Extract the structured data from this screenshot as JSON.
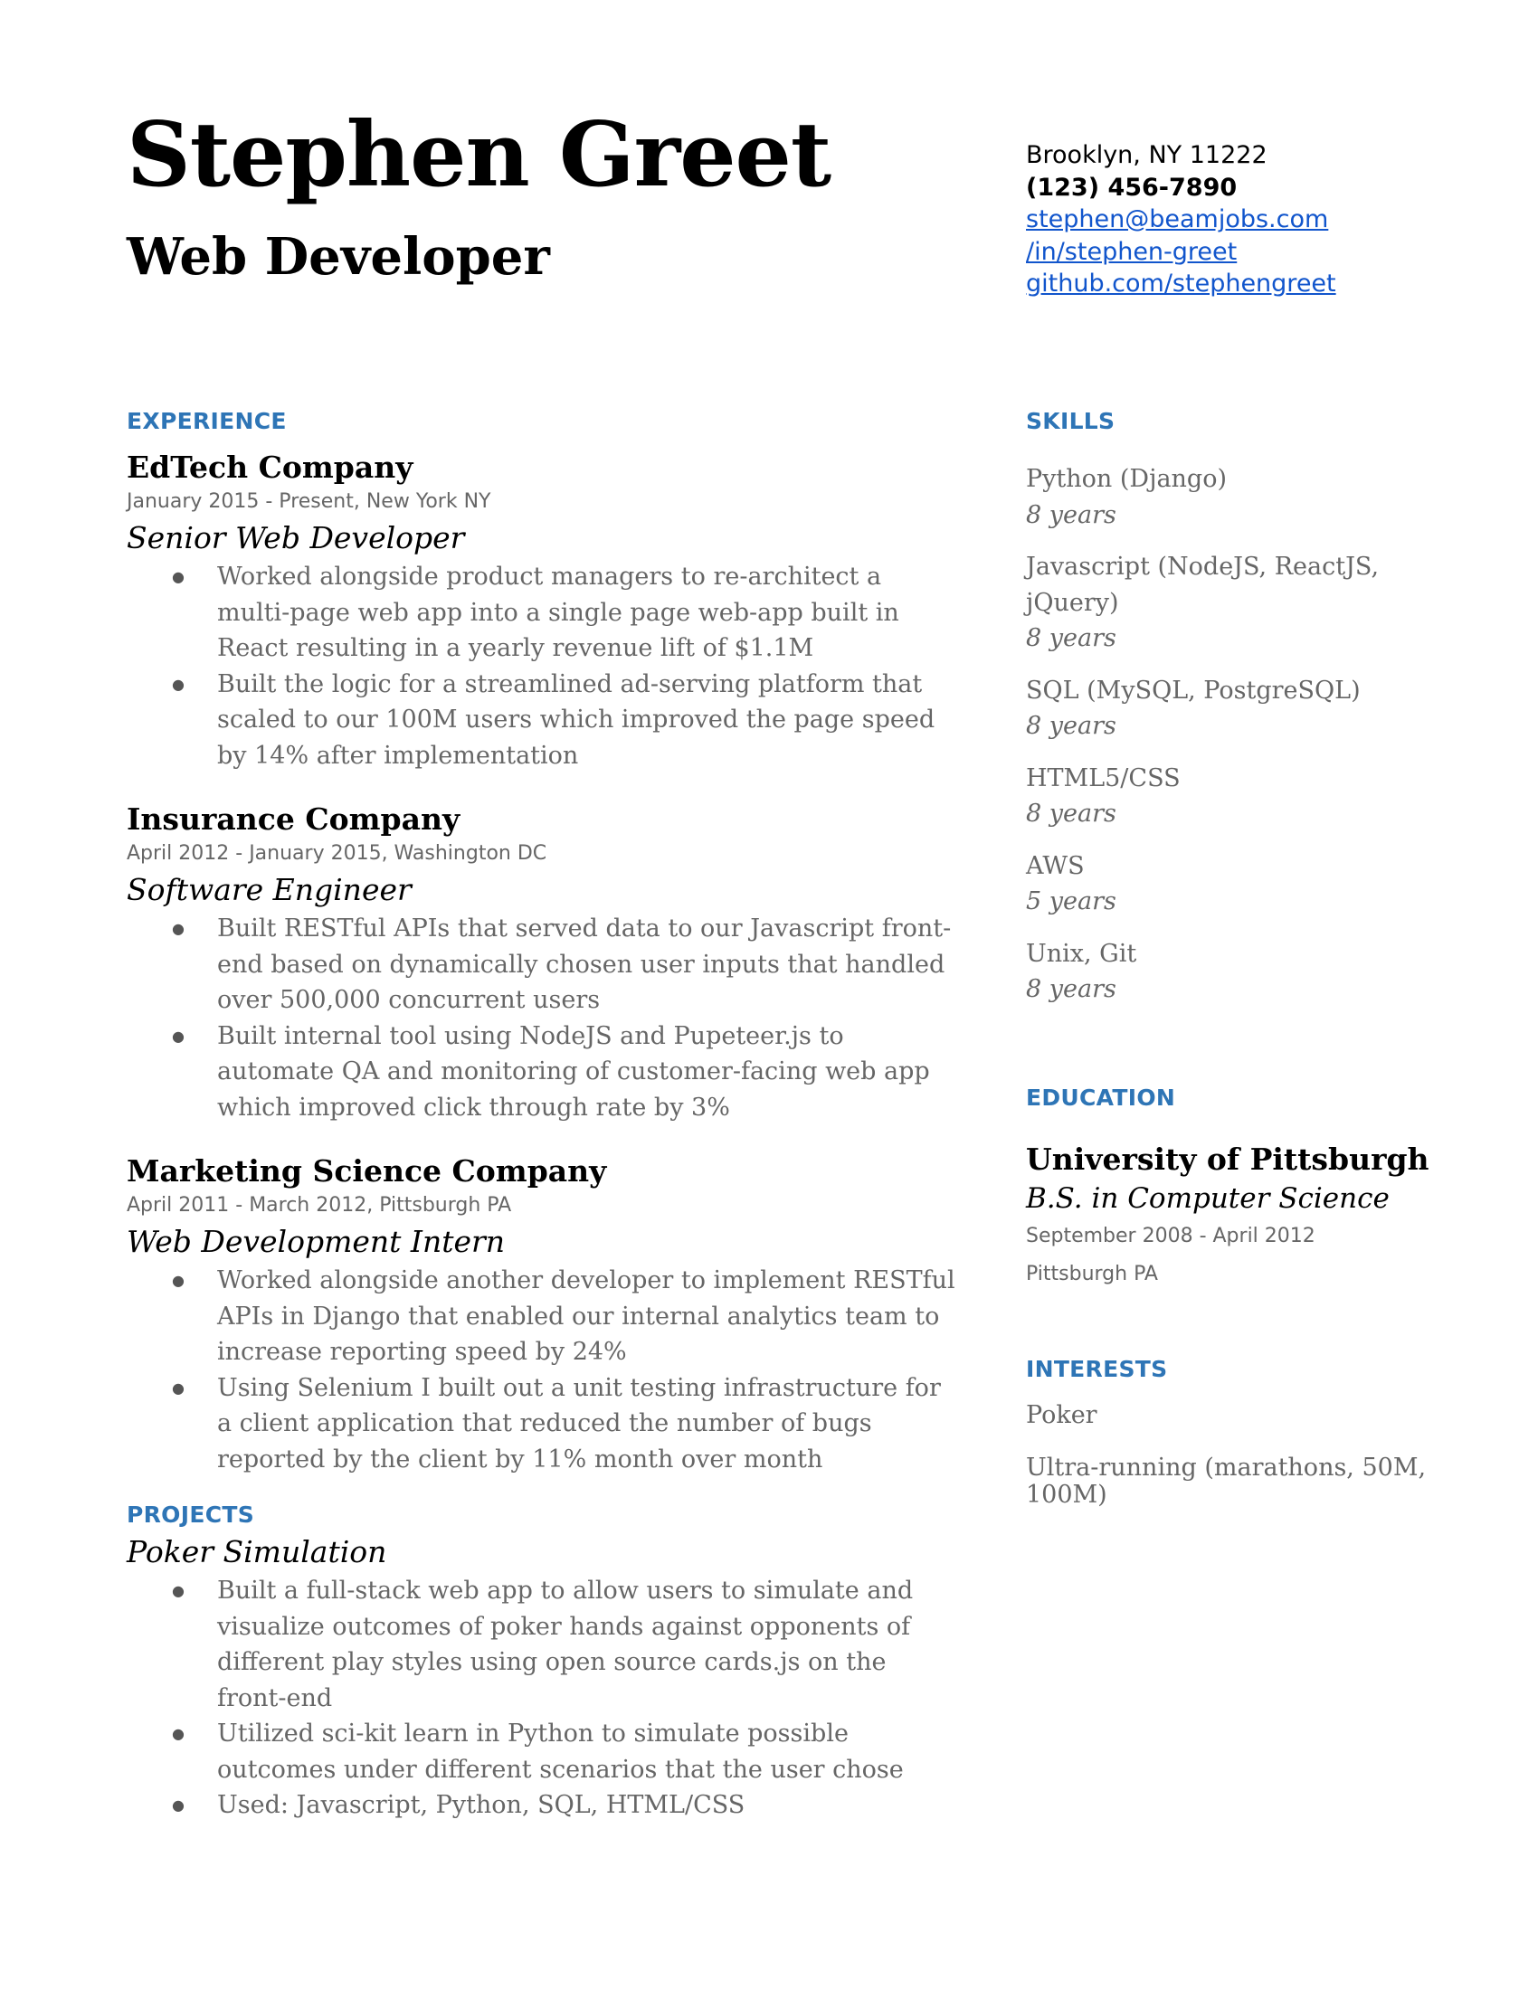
{
  "header": {
    "name": "Stephen Greet",
    "title": "Web Developer",
    "contact": {
      "address": "Brooklyn, NY 11222",
      "phone": "(123) 456-7890",
      "email": "stephen@beamjobs.com",
      "linkedin": "/in/stephen-greet",
      "github": "github.com/stephengreet"
    }
  },
  "experience": {
    "heading": "EXPERIENCE",
    "jobs": [
      {
        "company": "EdTech Company",
        "dates": "January 2015 - Present, New York NY",
        "role": "Senior Web Developer",
        "bullets": [
          "Worked alongside product managers to re-architect a multi-page web app into a single page web-app built in React resulting in a yearly revenue lift of $1.1M",
          "Built the logic for  a streamlined ad-serving platform that scaled to our 100M users which improved the page speed by 14% after implementation"
        ]
      },
      {
        "company": "Insurance Company",
        "dates": "April 2012 - January 2015, Washington DC",
        "role": "Software Engineer",
        "bullets": [
          "Built RESTful APIs that served data to our Javascript front-end based on dynamically chosen user inputs that handled over 500,000 concurrent users",
          "Built internal tool using NodeJS and Pupeteer.js to automate QA and monitoring of customer-facing web app which improved click through rate by 3%"
        ]
      },
      {
        "company": "Marketing Science Company",
        "dates": "April 2011 - March 2012, Pittsburgh PA",
        "role": "Web Development Intern",
        "bullets": [
          "Worked alongside another developer to implement RESTful APIs in Django that enabled our internal analytics team to increase reporting speed by 24%",
          "Using Selenium I built out a unit testing infrastructure for a client application that reduced the number of bugs reported by the client by 11% month over month"
        ]
      }
    ]
  },
  "projects": {
    "heading": "PROJECTS",
    "items": [
      {
        "name": "Poker Simulation",
        "bullets": [
          "Built a full-stack web app to allow users to simulate and visualize outcomes of poker hands against opponents of different play styles using open source cards.js on the front-end",
          "Utilized  sci-kit learn in Python to simulate possible outcomes under different scenarios that the user chose",
          "Used: Javascript, Python, SQL, HTML/CSS"
        ]
      }
    ]
  },
  "skills": {
    "heading": "SKILLS",
    "items": [
      {
        "name": "Python (Django)",
        "years": "8 years"
      },
      {
        "name": "Javascript (NodeJS, ReactJS, jQuery)",
        "years": "8 years"
      },
      {
        "name": "SQL  (MySQL, PostgreSQL)",
        "years": "8 years"
      },
      {
        "name": "HTML5/CSS",
        "years": "8 years"
      },
      {
        "name": "AWS",
        "years": "5 years"
      },
      {
        "name": "Unix, Git",
        "years": "8 years"
      }
    ]
  },
  "education": {
    "heading": "EDUCATION",
    "school": "University of Pittsburgh",
    "degree": "B.S. in Computer Science",
    "dates": "September 2008 - April 2012",
    "location": "Pittsburgh PA"
  },
  "interests": {
    "heading": "INTERESTS",
    "items": [
      "Poker",
      "Ultra-running (marathons, 50M, 100M)"
    ]
  },
  "colors": {
    "section_heading": "#2e75b6",
    "link": "#1155cc",
    "body_text": "#666666"
  }
}
